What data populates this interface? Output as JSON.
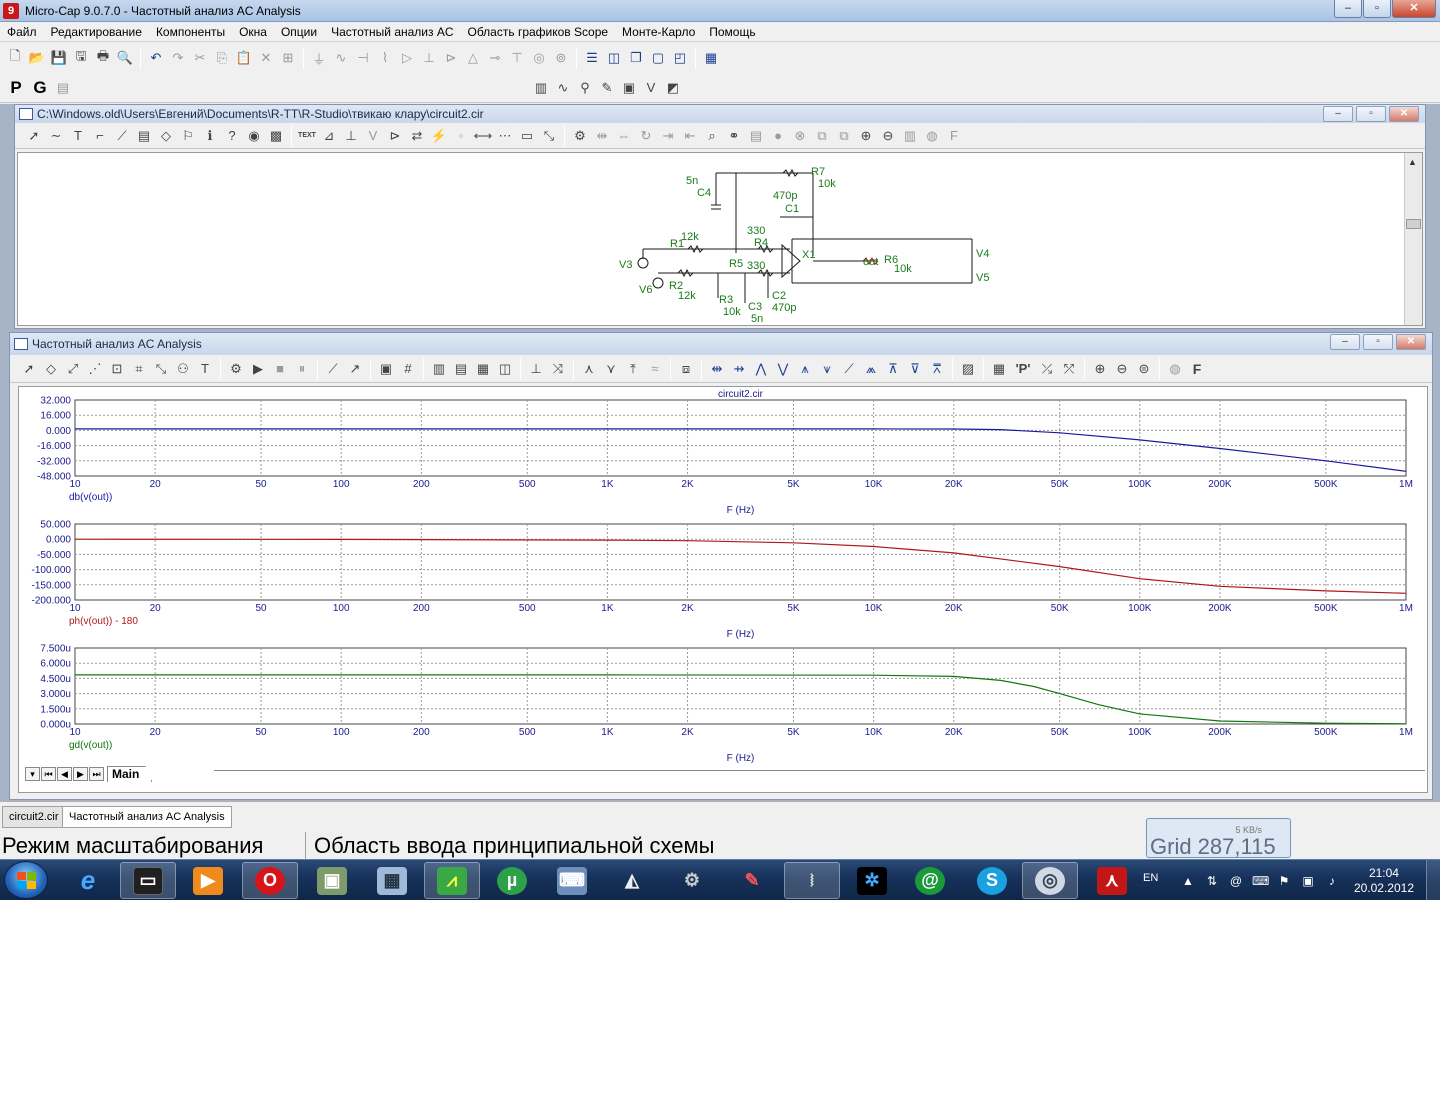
{
  "window": {
    "title": "Micro-Cap 9.0.7.0 - Частотный анализ AC Analysis",
    "app_icon_letter": "9",
    "minimize": "–",
    "maximize": "▫",
    "close": "✕"
  },
  "menu": [
    "Файл",
    "Редактирование",
    "Компоненты",
    "Окна",
    "Опции",
    "Частотный анализ AC",
    "Область графиков Scope",
    "Монте-Карло",
    "Помощь"
  ],
  "toolbar2": {
    "p_label": "P",
    "g_label": "G"
  },
  "schematic": {
    "title": "C:\\Windows.old\\Users\\Евгений\\Documents\\R-TT\\R-Studio\\твикаю клару\\circuit2.cir",
    "text_tool": "TEXT",
    "labels": {
      "c4_val": "5n",
      "c4": "C4",
      "r7": "R7",
      "r7_val": "10k",
      "c1_val": "470p",
      "c1": "C1",
      "r4_val": "330",
      "r4": "R4",
      "r1": "R1",
      "r1_val": "12k",
      "x1": "X1",
      "v3": "V3",
      "r5": "R5",
      "r5_val": "330",
      "out": "out",
      "r6": "R6",
      "r6_val": "10k",
      "v4": "V4",
      "v5": "V5",
      "v6": "V6",
      "r2": "R2",
      "r2_val": "12k",
      "r3": "R3",
      "r3_val": "10k",
      "c3": "C3",
      "c3_val": "5n",
      "c2": "C2",
      "c2_val": "470p"
    }
  },
  "analysis": {
    "title": "Частотный анализ AC Analysis",
    "p_button": "'P'",
    "f_button": "F",
    "main_tab": "Main"
  },
  "chart_data": [
    {
      "type": "line",
      "title": "circuit2.cir",
      "xlabel": "F (Hz)",
      "x_scale": "log",
      "xlim": [
        10,
        1000000
      ],
      "x_ticks": [
        "10",
        "20",
        "50",
        "100",
        "200",
        "500",
        "1K",
        "2K",
        "5K",
        "10K",
        "20K",
        "50K",
        "100K",
        "200K",
        "500K",
        "1M"
      ],
      "ylim": [
        -48,
        32
      ],
      "y_ticks": [
        "32.000",
        "16.000",
        "0.000",
        "-16.000",
        "-32.000",
        "-48.000"
      ],
      "grid": true,
      "series": [
        {
          "name": "db(v(out))",
          "color": "#1a1aa0",
          "x": [
            10,
            100,
            1000,
            10000,
            20000,
            30000,
            50000,
            100000,
            200000,
            500000,
            1000000
          ],
          "y": [
            1.6,
            1.6,
            1.6,
            1.6,
            1.5,
            0.8,
            -2.5,
            -10,
            -19,
            -32,
            -43
          ]
        }
      ]
    },
    {
      "type": "line",
      "xlabel": "F (Hz)",
      "x_scale": "log",
      "xlim": [
        10,
        1000000
      ],
      "x_ticks": [
        "10",
        "20",
        "50",
        "100",
        "200",
        "500",
        "1K",
        "2K",
        "5K",
        "10K",
        "20K",
        "50K",
        "100K",
        "200K",
        "500K",
        "1M"
      ],
      "ylim": [
        -200,
        50
      ],
      "y_ticks": [
        "50.000",
        "0.000",
        "-50.000",
        "-100.000",
        "-150.000",
        "-200.000"
      ],
      "grid": true,
      "series": [
        {
          "name": "ph(v(out)) - 180",
          "color": "#b01818",
          "x": [
            10,
            100,
            1000,
            2000,
            5000,
            10000,
            20000,
            50000,
            100000,
            200000,
            500000,
            1000000
          ],
          "y": [
            0,
            -0.5,
            -3,
            -5,
            -12,
            -24,
            -45,
            -90,
            -130,
            -155,
            -170,
            -178
          ]
        }
      ]
    },
    {
      "type": "line",
      "xlabel": "F (Hz)",
      "x_scale": "log",
      "xlim": [
        10,
        1000000
      ],
      "x_ticks": [
        "10",
        "20",
        "50",
        "100",
        "200",
        "500",
        "1K",
        "2K",
        "5K",
        "10K",
        "20K",
        "50K",
        "100K",
        "200K",
        "500K",
        "1M"
      ],
      "ylim": [
        0,
        7.5
      ],
      "y_ticks": [
        "7.500u",
        "6.000u",
        "4.500u",
        "3.000u",
        "1.500u",
        "0.000u"
      ],
      "grid": true,
      "series": [
        {
          "name": "gd(v(out))",
          "color": "#117711",
          "x": [
            10,
            100,
            1000,
            10000,
            20000,
            30000,
            40000,
            50000,
            70000,
            100000,
            200000,
            500000,
            1000000
          ],
          "y": [
            4.85,
            4.85,
            4.85,
            4.82,
            4.7,
            4.3,
            3.7,
            3.0,
            1.9,
            1.0,
            0.3,
            0.08,
            0.02
          ]
        }
      ]
    }
  ],
  "doc_tabs": [
    "circuit2.cir",
    "Частотный анализ AC Analysis"
  ],
  "status": {
    "mode": "Режим масштабирования",
    "area": "Область ввода принципиальной схемы",
    "grid": "Grid 287,115",
    "rate": "5 KB/s"
  },
  "taskbar": {
    "lang": "EN",
    "time": "21:04",
    "date": "20.02.2012"
  }
}
